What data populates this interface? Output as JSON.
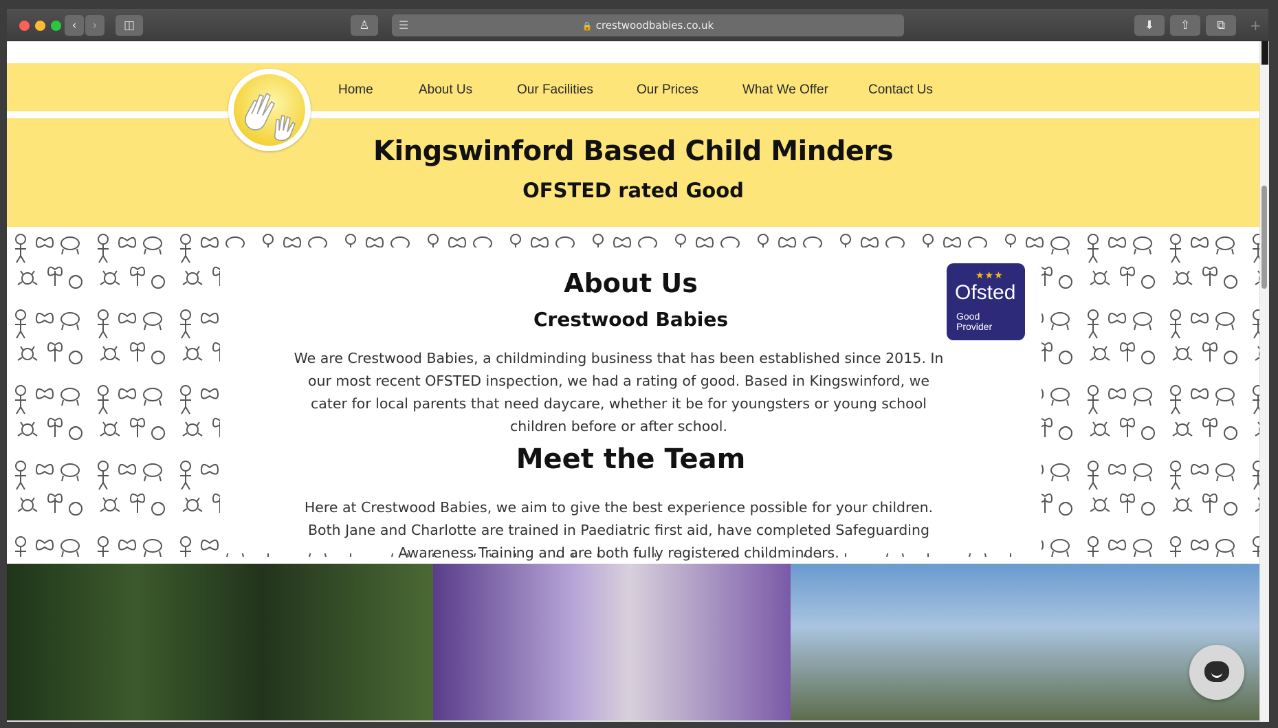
{
  "browser": {
    "url": "crestwoodbabies.co.uk",
    "back_icon": "chevron-left-icon",
    "forward_icon": "chevron-right-icon"
  },
  "nav": {
    "items": [
      "Home",
      "About Us",
      "Our Facilities",
      "Our Prices",
      "What We Offer",
      "Contact Us"
    ]
  },
  "header": {
    "title": "Kingswinford Based Child Minders",
    "subtitle": "OFSTED rated Good"
  },
  "about": {
    "heading": "About Us",
    "subheading": "Crestwood Babies",
    "paragraph": "We are Crestwood Babies, a childminding business that has been established since 2015. In our most recent OFSTED inspection, we had a rating of good. Based in Kingswinford, we cater for local parents that need daycare, whether it be for youngsters or young school children before or after school."
  },
  "team": {
    "heading": "Meet the Team",
    "paragraph": "Here at Crestwood Babies, we aim to give the best experience possible for your children. Both Jane and Charlotte are trained in Paediatric first aid, have completed Safeguarding Awareness Training and are both fully registered childminders."
  },
  "ofsted_badge": {
    "name": "Ofsted",
    "rating": "Good Provider",
    "stars": "★★★",
    "color": "#2e2a7a"
  },
  "colors": {
    "header_yellow": "#fde57a",
    "badge_navy": "#2e2a7a"
  }
}
